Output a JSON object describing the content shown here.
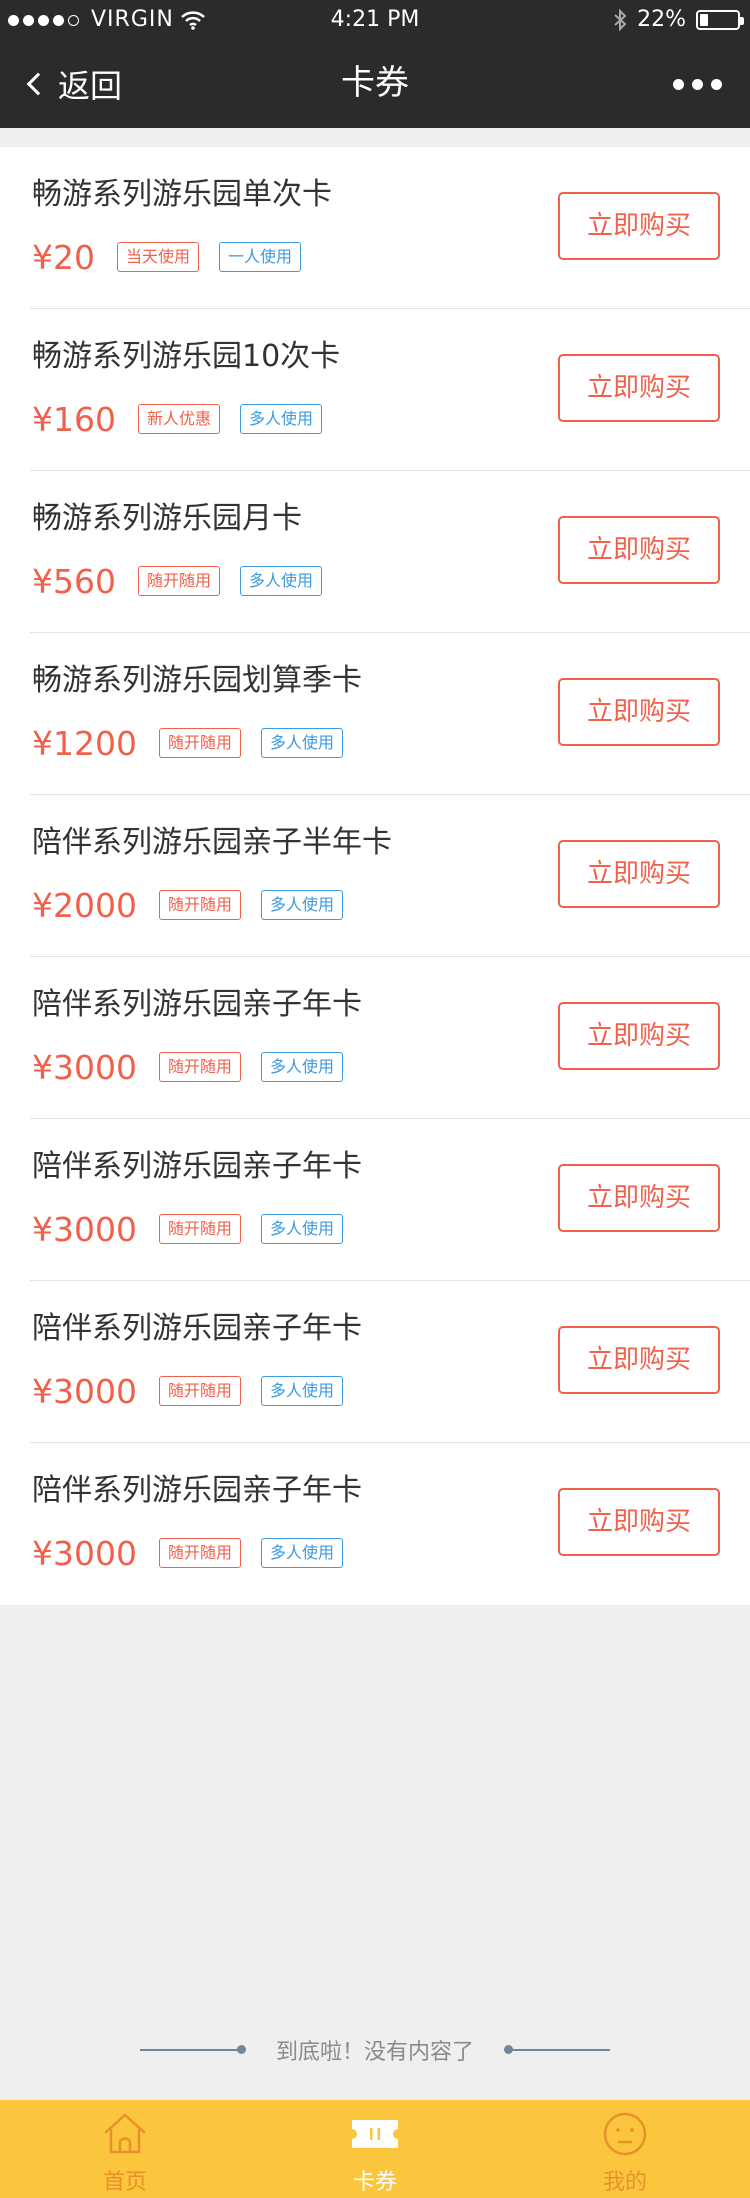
{
  "status_bar": {
    "carrier": "VIRGIN",
    "time": "4:21 PM",
    "battery": "22%",
    "battery_level": 0.22,
    "signal_bars": 4
  },
  "nav": {
    "back_label": "返回",
    "title": "卡券"
  },
  "colors": {
    "accent_red": "#f0604a",
    "tag_blue": "#3c9ae0",
    "tabbar_yellow": "#fbc63d"
  },
  "buy_label": "立即购买",
  "items": [
    {
      "name": "畅游系列游乐园单次卡",
      "price": "¥20",
      "tag1": "当天使用",
      "tag2": "一人使用"
    },
    {
      "name": "畅游系列游乐园10次卡",
      "price": "¥160",
      "tag1": "新人优惠",
      "tag2": "多人使用"
    },
    {
      "name": "畅游系列游乐园月卡",
      "price": "¥560",
      "tag1": "随开随用",
      "tag2": "多人使用"
    },
    {
      "name": "畅游系列游乐园划算季卡",
      "price": "¥1200",
      "tag1": "随开随用",
      "tag2": "多人使用"
    },
    {
      "name": "陪伴系列游乐园亲子半年卡",
      "price": "¥2000",
      "tag1": "随开随用",
      "tag2": "多人使用"
    },
    {
      "name": "陪伴系列游乐园亲子年卡",
      "price": "¥3000",
      "tag1": "随开随用",
      "tag2": "多人使用"
    },
    {
      "name": "陪伴系列游乐园亲子年卡",
      "price": "¥3000",
      "tag1": "随开随用",
      "tag2": "多人使用"
    },
    {
      "name": "陪伴系列游乐园亲子年卡",
      "price": "¥3000",
      "tag1": "随开随用",
      "tag2": "多人使用"
    },
    {
      "name": "陪伴系列游乐园亲子年卡",
      "price": "¥3000",
      "tag1": "随开随用",
      "tag2": "多人使用"
    }
  ],
  "end_text": "到底啦！没有内容了",
  "tabs": [
    {
      "label": "首页",
      "icon": "home-icon",
      "active": false
    },
    {
      "label": "卡券",
      "icon": "ticket-icon",
      "active": true
    },
    {
      "label": "我的",
      "icon": "smiley-icon",
      "active": false
    }
  ]
}
